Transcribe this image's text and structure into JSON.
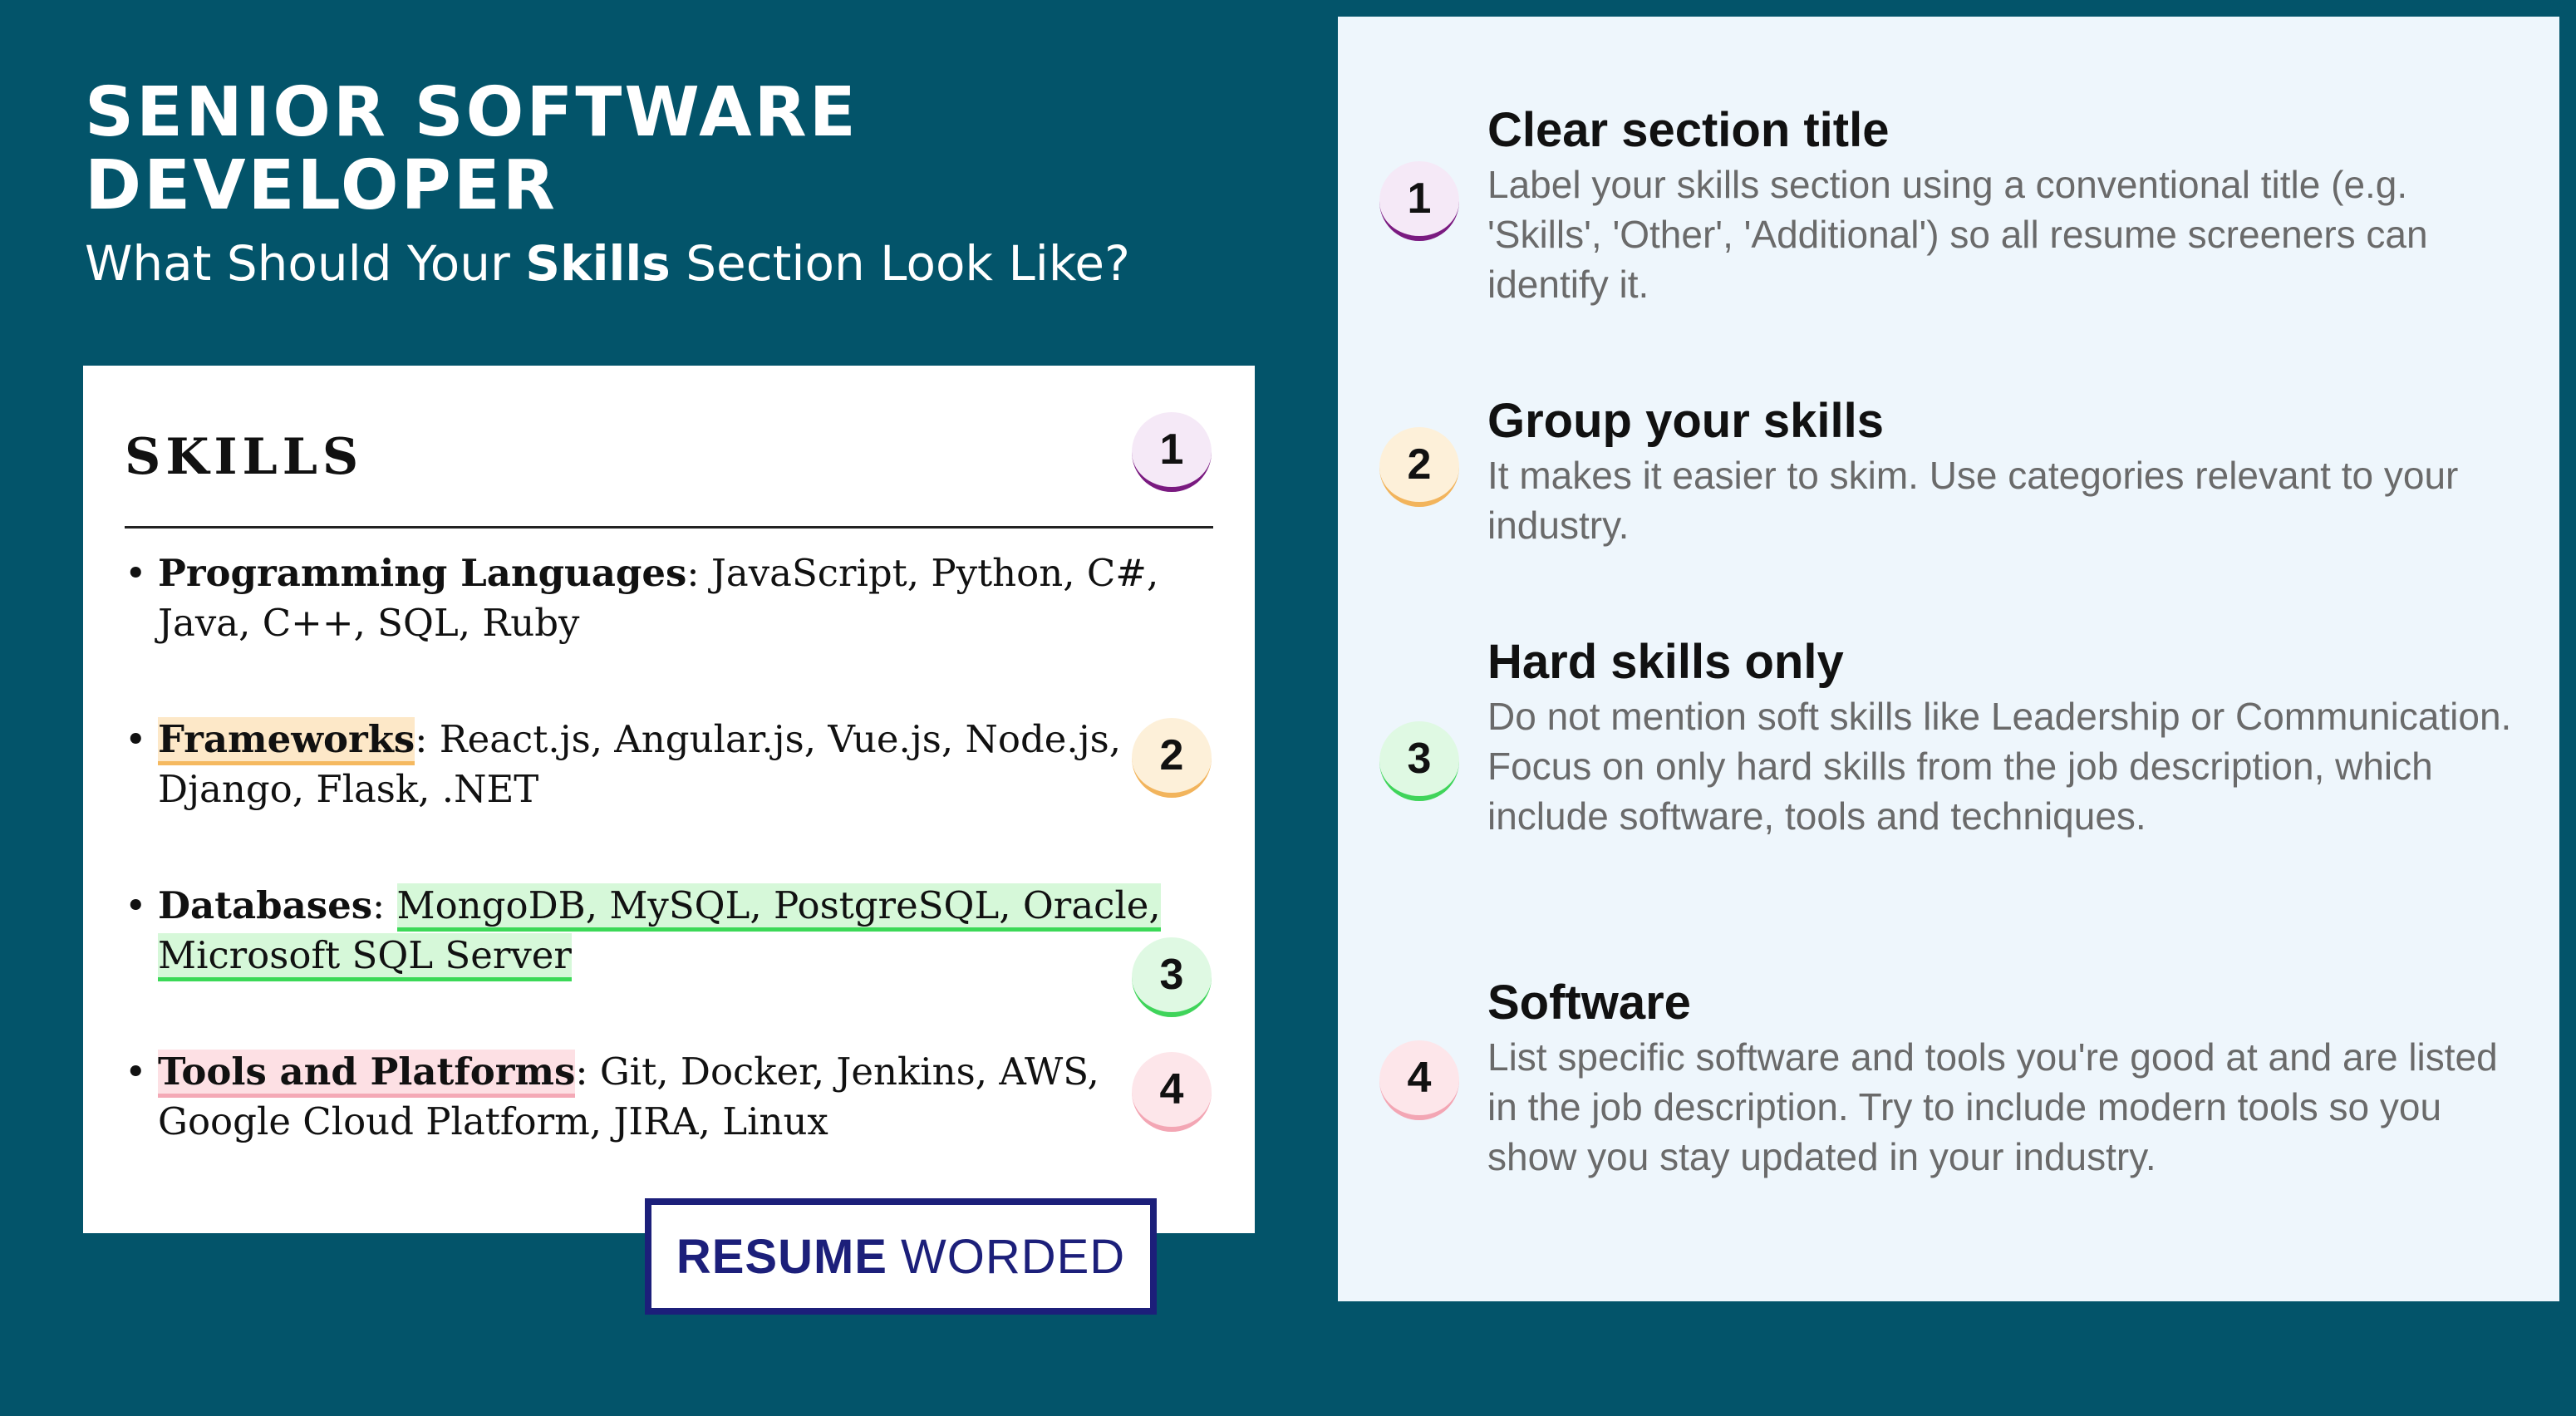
{
  "header": {
    "title_line1": "SENIOR SOFTWARE",
    "title_line2": "DEVELOPER",
    "subtitle_pre": "What Should Your ",
    "subtitle_bold": "Skills",
    "subtitle_post": " Section Look Like?"
  },
  "resume": {
    "heading": "SKILLS",
    "items": [
      {
        "label": "Programming Languages",
        "sep": ": ",
        "text": "JavaScript, Python, C#, Java, C++, SQL, Ruby"
      },
      {
        "label": "Frameworks",
        "sep": ": ",
        "text": "React.js, Angular.js, Vue.js, Node.js, Django, Flask, .NET"
      },
      {
        "label": "Databases",
        "sep": ": ",
        "text": "MongoDB, MySQL, PostgreSQL, Oracle, Microsoft SQL Server"
      },
      {
        "label": "Tools and Platforms",
        "sep": ": ",
        "text": "Git, Docker, Jenkins, AWS, Google Cloud Platform, JIRA, Linux"
      }
    ],
    "badges": [
      "1",
      "2",
      "3",
      "4"
    ]
  },
  "logo": {
    "bold": "RESUME",
    "light": "WORDED"
  },
  "tips": [
    {
      "num": "1",
      "title": "Clear section title",
      "body": "Label your skills section using a conventional title (e.g. 'Skills', 'Other', 'Additional') so all resume screeners can identify it."
    },
    {
      "num": "2",
      "title": "Group your skills",
      "body": "It makes it easier to skim. Use categories relevant to your industry."
    },
    {
      "num": "3",
      "title": "Hard skills only",
      "body": "Do not mention soft skills like Leadership or Communication. Focus on only hard skills from the job description, which include software, tools and techniques."
    },
    {
      "num": "4",
      "title": "Software",
      "body": "List specific software and tools you're good at and are listed in the job description. Try to include modern tools so you show you stay updated in your industry."
    }
  ],
  "colors": {
    "background": "#03546a",
    "panel": "#eef6fc",
    "badge1": "#7a1a80",
    "badge2": "#f2b45c",
    "badge3": "#3fd45a",
    "badge4": "#f3a6b4",
    "logo": "#1c1f7a"
  }
}
